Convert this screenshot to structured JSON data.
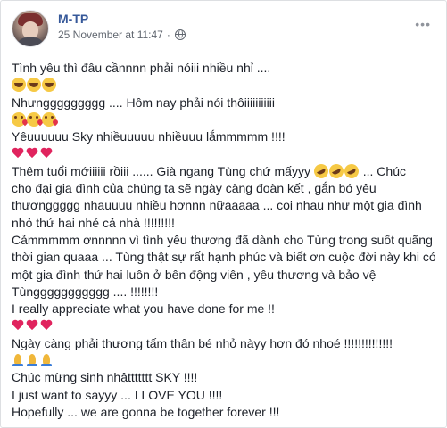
{
  "post": {
    "author": "M-TP",
    "timestamp": "25 November at 11:47",
    "separator": "·",
    "more_label": "•••"
  },
  "lines": [
    "Tình yêu thì đâu cầnnnn phải nóiii nhiều nhỉ ....",
    "Nhưnggggggggg .... Hôm nay phải nói thôiiiiiiiiiii",
    "Yêuuuuuu Sky nhiềuuuuu nhiềuuu lắmmmmm !!!!",
    "Thêm tuổi mớiiiiii rồiii ...... Già ngang Tùng chứ mấyyy",
    "... Chúc",
    "cho đại gia đình của chúng ta sẽ ngày càng đoàn kết , gắn bó yêu thươnggggg nhauuuu nhiều hơnnn nữaaaaa ... coi nhau như một gia đình nhỏ thứ hai nhé cả nhà !!!!!!!!!",
    "Cảmmmmm ơnnnnn vì tình yêu thương đã dành cho Tùng trong suốt quãng thời gian quaaa ... Tùng thật sự rất hạnh phúc và biết ơn cuộc đời này khi có một gia đình thứ hai luôn ở bên động viên , yêu thương và bảo vệ Tùnggggggggggg .... !!!!!!!!",
    "I really appreciate what you have done for me !!",
    "Ngày càng phải thương tấm thân bé nhỏ nàyy hơn đó nhoé !!!!!!!!!!!!!!",
    "Chúc mừng sinh nhậttttttt SKY !!!!",
    "I just want to sayyy ... I LOVE YOU !!!!",
    "Hopefully ... we are gonna be together forever !!!"
  ],
  "icons": {
    "laugh": "face-with-tears-of-joy",
    "kiss": "face-blowing-a-kiss",
    "heart": "red-heart",
    "rofl": "rolling-on-the-floor-laughing",
    "pray": "folded-hands"
  }
}
